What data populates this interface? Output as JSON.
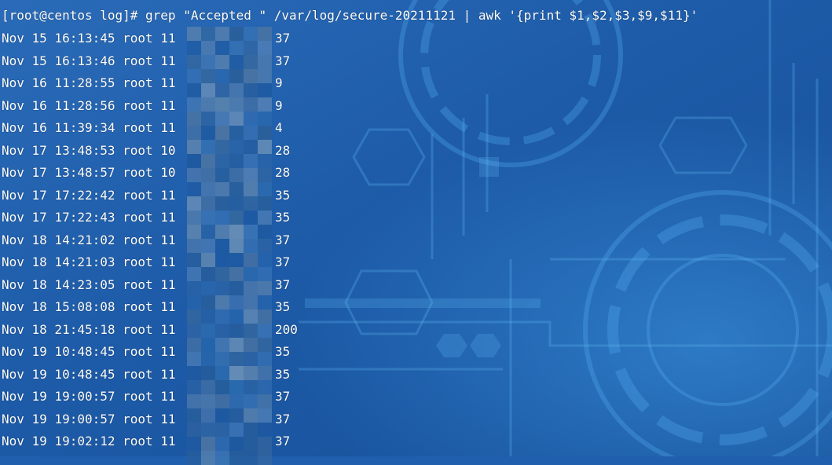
{
  "terminal": {
    "prompt": "[root@centos log]#",
    "command": " grep \"Accepted \" /var/log/secure-20211121 | awk '{print $1,$2,$3,$9,$11}'",
    "rows": [
      {
        "prefix": "Nov 15 16:13:45 root 11",
        "suffix": "37"
      },
      {
        "prefix": "Nov 15 16:13:46 root 11",
        "suffix": "37"
      },
      {
        "prefix": "Nov 16 11:28:55 root 11",
        "suffix": "9"
      },
      {
        "prefix": "Nov 16 11:28:56 root 11",
        "suffix": "9"
      },
      {
        "prefix": "Nov 16 11:39:34 root 11",
        "suffix": "4"
      },
      {
        "prefix": "Nov 17 13:48:53 root 10",
        "suffix": "28"
      },
      {
        "prefix": "Nov 17 13:48:57 root 10",
        "suffix": "28"
      },
      {
        "prefix": "Nov 17 17:22:42 root 11",
        "suffix": "35"
      },
      {
        "prefix": "Nov 17 17:22:43 root 11",
        "suffix": "35"
      },
      {
        "prefix": "Nov 18 14:21:02 root 11",
        "suffix": "37"
      },
      {
        "prefix": "Nov 18 14:21:03 root 11",
        "suffix": "37"
      },
      {
        "prefix": "Nov 18 14:23:05 root 11",
        "suffix": "37"
      },
      {
        "prefix": "Nov 18 15:08:08 root 11",
        "suffix": "35"
      },
      {
        "prefix": "Nov 18 21:45:18 root 11",
        "suffix": "200"
      },
      {
        "prefix": "Nov 19 10:48:45 root 11",
        "suffix": "35"
      },
      {
        "prefix": "Nov 19 10:48:45 root 11",
        "suffix": "35"
      },
      {
        "prefix": "Nov 19 19:00:57 root 11",
        "suffix": "37"
      },
      {
        "prefix": "Nov 19 19:00:57 root 11",
        "suffix": "37"
      },
      {
        "prefix": "Nov 19 19:02:12 root 11",
        "suffix": "37"
      }
    ]
  },
  "colors": {
    "background": "#1f5fae",
    "text": "#ffffff",
    "accent": "#4fb3ff"
  }
}
